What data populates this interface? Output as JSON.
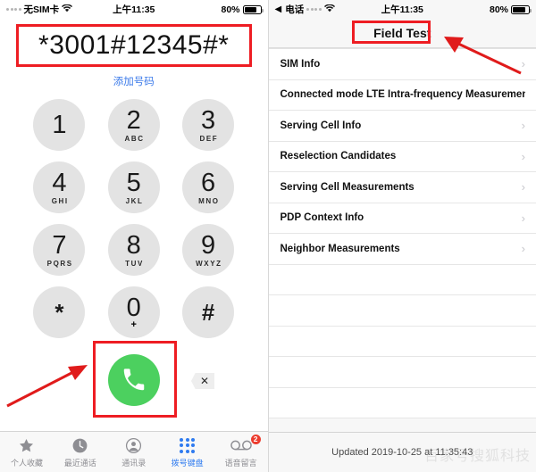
{
  "left": {
    "status": {
      "carrier": "无SIM卡",
      "time": "上午11:35",
      "battery_pct": "80%"
    },
    "dialed_number": "*3001#12345#*",
    "add_number_label": "添加号码",
    "keys": [
      {
        "digit": "1",
        "letters": ""
      },
      {
        "digit": "2",
        "letters": "ABC"
      },
      {
        "digit": "3",
        "letters": "DEF"
      },
      {
        "digit": "4",
        "letters": "GHI"
      },
      {
        "digit": "5",
        "letters": "JKL"
      },
      {
        "digit": "6",
        "letters": "MNO"
      },
      {
        "digit": "7",
        "letters": "PQRS"
      },
      {
        "digit": "8",
        "letters": "TUV"
      },
      {
        "digit": "9",
        "letters": "WXYZ"
      },
      {
        "digit": "*",
        "letters": ""
      },
      {
        "digit": "0",
        "letters": "+"
      },
      {
        "digit": "#",
        "letters": ""
      }
    ],
    "delete_glyph": "✕",
    "tabs": [
      {
        "label": "个人收藏",
        "icon": "star-icon",
        "active": false,
        "badge": ""
      },
      {
        "label": "最近通话",
        "icon": "clock-icon",
        "active": false,
        "badge": ""
      },
      {
        "label": "通讯录",
        "icon": "contact-icon",
        "active": false,
        "badge": ""
      },
      {
        "label": "拨号键盘",
        "icon": "keypad-icon",
        "active": true,
        "badge": ""
      },
      {
        "label": "语音留言",
        "icon": "voicemail-icon",
        "active": false,
        "badge": "2"
      }
    ]
  },
  "right": {
    "status": {
      "back_label": "电话",
      "time": "上午11:35",
      "battery_pct": "80%"
    },
    "title": "Field Test",
    "rows": [
      {
        "label": "SIM Info",
        "chevron": true
      },
      {
        "label": "Connected mode LTE Intra-frequency Measuremen",
        "chevron": false
      },
      {
        "label": "Serving Cell Info",
        "chevron": true
      },
      {
        "label": "Reselection Candidates",
        "chevron": true
      },
      {
        "label": "Serving Cell Measurements",
        "chevron": true
      },
      {
        "label": "PDP Context Info",
        "chevron": true
      },
      {
        "label": "Neighbor Measurements",
        "chevron": true
      }
    ],
    "empty_rows": 5,
    "footer": "Updated 2019-10-25 at 11:35:43",
    "watermark": "百家号搜狐科技"
  },
  "annotations": {
    "highlight_color": "#ee1d23",
    "arrow_color": "#e01b1b"
  }
}
